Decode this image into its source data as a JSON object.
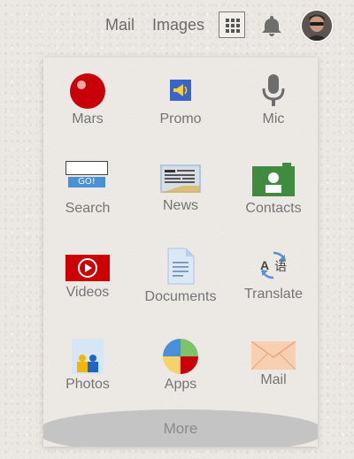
{
  "topbar": {
    "mail_label": "Mail",
    "images_label": "Images",
    "apps_icon": "apps-grid-icon",
    "notifications_icon": "bell-icon",
    "avatar_icon": "user-avatar"
  },
  "apps": [
    {
      "label": "Mars",
      "icon": "mars-icon"
    },
    {
      "label": "Promo",
      "icon": "promo-icon"
    },
    {
      "label": "Mic",
      "icon": "microphone-icon"
    },
    {
      "label": "Search",
      "icon": "search-go-icon"
    },
    {
      "label": "News",
      "icon": "news-icon"
    },
    {
      "label": "Contacts",
      "icon": "contacts-icon"
    },
    {
      "label": "Videos",
      "icon": "video-play-icon"
    },
    {
      "label": "Documents",
      "icon": "document-icon"
    },
    {
      "label": "Translate",
      "icon": "translate-icon"
    },
    {
      "label": "Photos",
      "icon": "photos-icon"
    },
    {
      "label": "Apps",
      "icon": "apps-pie-icon"
    },
    {
      "label": "Mail",
      "icon": "mail-envelope-icon"
    }
  ],
  "search_icon_button": "GO!",
  "translate_glyphs": {
    "latin": "A",
    "cjk": "语"
  },
  "more_label": "More",
  "colors": {
    "mars_red": "#c8000a",
    "youtube_red": "#cc0000",
    "contacts_green": "#3f8b3f",
    "promo_blue": "#3a64c8",
    "text_grey": "#757575"
  }
}
